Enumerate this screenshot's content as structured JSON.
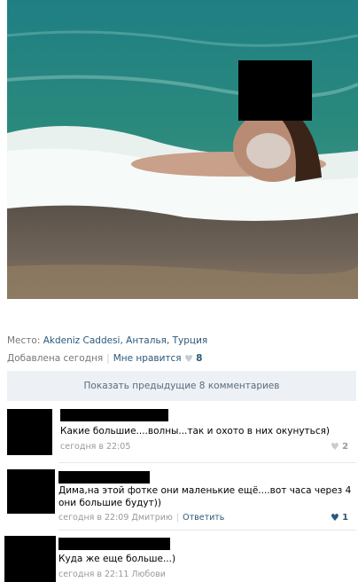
{
  "post": {
    "place_label": "Место:",
    "place_value": "Akdeniz Caddesi, Анталья, Турция",
    "added": "Добавлена сегодня",
    "like_label": "Мне нравится",
    "like_count": "8",
    "show_prev": "Показать предыдущие 8 комментариев"
  },
  "comments": [
    {
      "text": "Какие большие....волны...так и охото в них окунуться)",
      "time": "сегодня в 22:05",
      "likes": "2"
    },
    {
      "text": "Дима,на этой фотке они маленькие ещё....вот часа через 4 они большие будут))",
      "time": "сегодня в 22:09 Дмитрию",
      "reply": "Ответить",
      "likes": "1"
    },
    {
      "text": "Куда же еще больше...)",
      "time": "сегодня в 22:11 Любови"
    }
  ],
  "icons": {
    "like": "heart-icon"
  },
  "colors": {
    "link": "#2b587a",
    "meta": "#777777",
    "bar": "#edf1f5"
  }
}
